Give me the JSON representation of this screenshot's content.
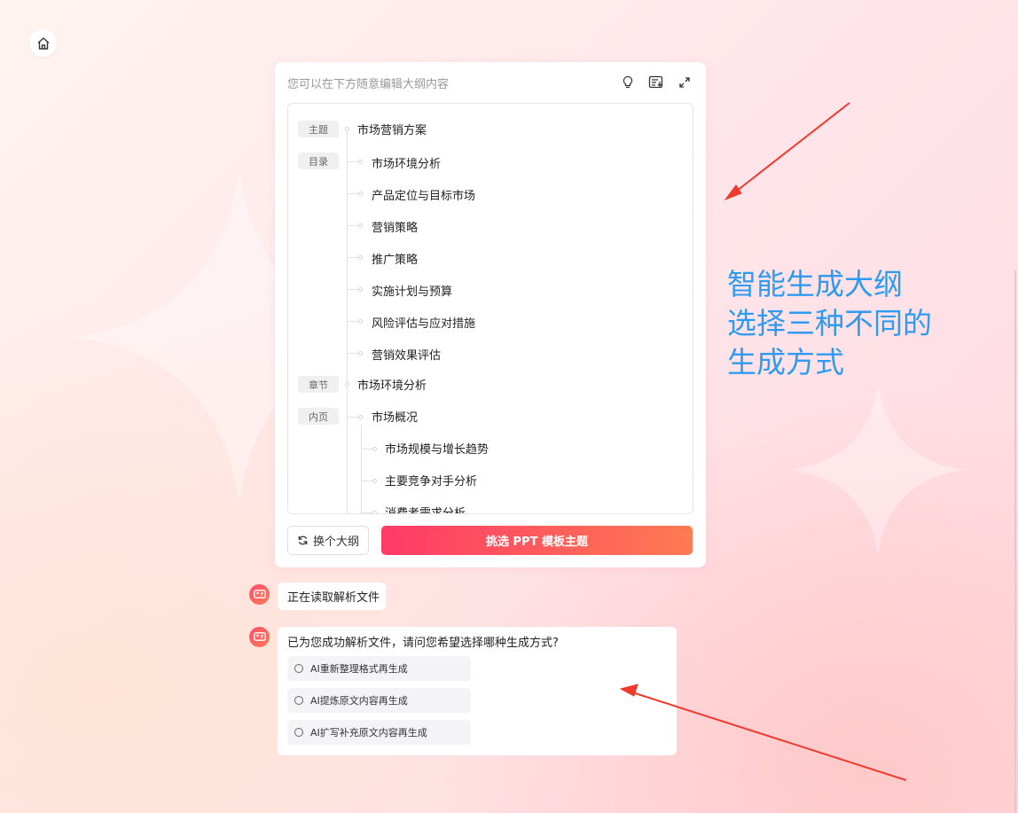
{
  "card": {
    "hint": "您可以在下方随意编辑大纲内容",
    "icons": [
      "lightbulb-icon",
      "export-list-icon",
      "expand-icon"
    ]
  },
  "outline": {
    "theme_tag": "主题",
    "theme_title": "市场营销方案",
    "toc_tag": "目录",
    "toc_items": [
      "市场环境分析",
      "产品定位与目标市场",
      "营销策略",
      "推广策略",
      "实施计划与预算",
      "风险评估与应对措施",
      "营销效果评估"
    ],
    "chapter_tag": "章节",
    "chapter_title": "市场环境分析",
    "page_tag": "内页",
    "page_title": "市场概况",
    "page_items": [
      "市场规模与增长趋势",
      "主要竞争对手分析",
      "消费者需求分析"
    ]
  },
  "buttons": {
    "swap_label": "换个大纲",
    "primary_label": "挑选 PPT 模板主题"
  },
  "chat": {
    "msg1": "正在读取解析文件",
    "msg2": "已为您成功解析文件，请问您希望选择哪种生成方式?",
    "options": [
      "AI重新整理格式再生成",
      "AI提炼原文内容再生成",
      "AI扩写补充原文内容再生成"
    ]
  },
  "annotation": {
    "line1": "智能生成大纲",
    "line2": "选择三种不同的",
    "line3": "生成方式"
  },
  "colors": {
    "accent_start": "#ff3a67",
    "accent_end": "#ff7a52",
    "annotation": "#2f9bf0",
    "arrow": "#f03a2e"
  }
}
